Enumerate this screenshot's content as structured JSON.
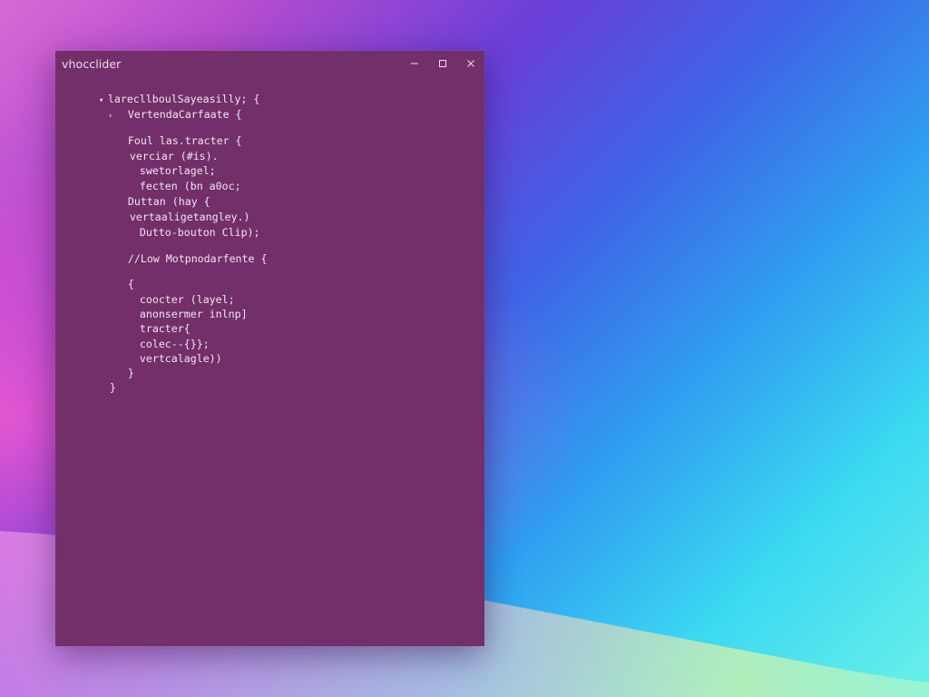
{
  "window": {
    "title": "vhocclider",
    "controls": {
      "minimize_icon": "minimize-icon",
      "maximize_icon": "maximize-icon",
      "close_icon": "close-icon"
    }
  },
  "editor": {
    "lines": [
      {
        "fold": "expanded",
        "text": "larecllboulSayeasilly; {"
      },
      {
        "fold": "collapsed",
        "text": "VertendaCarfaate {"
      },
      {
        "fold": "",
        "text": "Foul las.tracter {"
      },
      {
        "fold": "",
        "text": "verciar (#is)."
      },
      {
        "fold": "",
        "text": "swetorlagel;"
      },
      {
        "fold": "",
        "text": "fecten (bn a0oc;"
      },
      {
        "fold": "",
        "text": "Duttan (hay {"
      },
      {
        "fold": "",
        "text": "vertaaligetangley.)"
      },
      {
        "fold": "",
        "text": "Dutto-bouton Clip);"
      },
      {
        "fold": "",
        "text": "//Low Motpnodarfente {"
      },
      {
        "fold": "",
        "text": "{"
      },
      {
        "fold": "",
        "text": "coocter (layel;"
      },
      {
        "fold": "",
        "text": "anonsermer inlnp]"
      },
      {
        "fold": "",
        "text": "tracter{"
      },
      {
        "fold": "",
        "text": "colec--{}};"
      },
      {
        "fold": "",
        "text": "vertcalagle))"
      },
      {
        "fold": "",
        "text": "}"
      },
      {
        "fold": "",
        "text": "}"
      }
    ]
  },
  "colors": {
    "window_bg": "#722f6a",
    "code_text": "#f2e6f2",
    "title_text": "#ecdcec"
  }
}
